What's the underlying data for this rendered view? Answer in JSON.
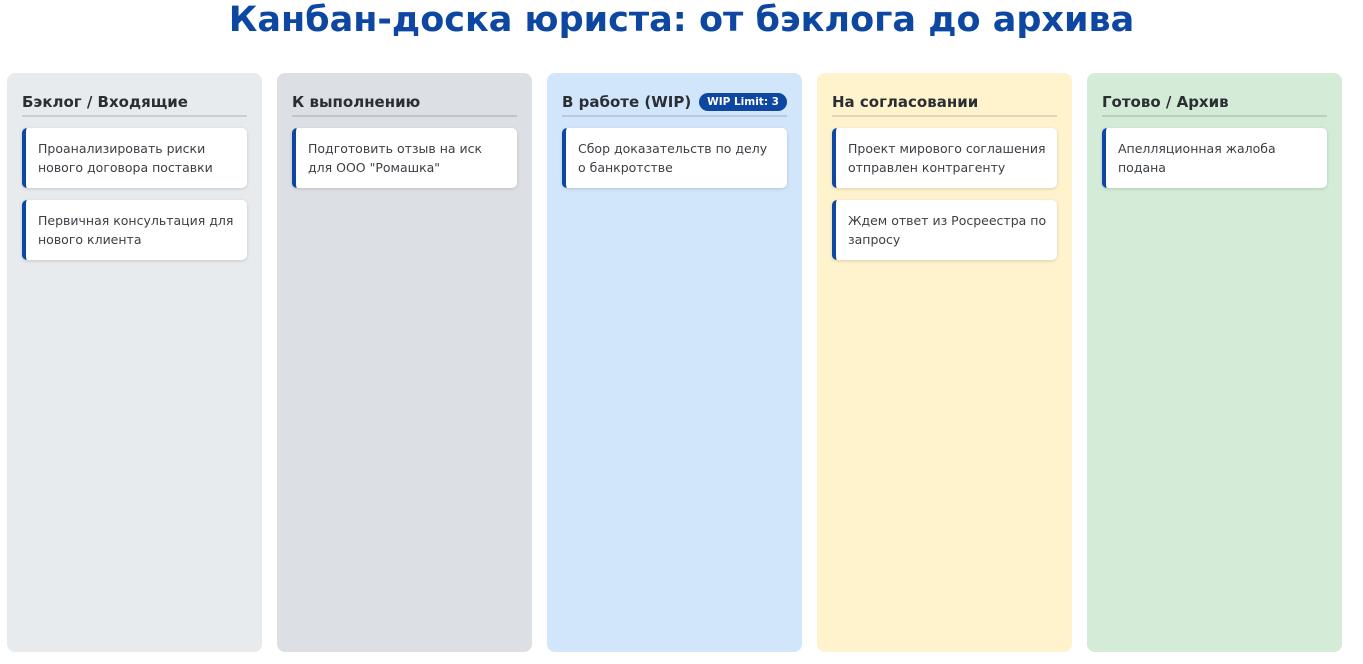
{
  "page": {
    "title": "Канбан-доска юриста: от бэклога до архива"
  },
  "colors": {
    "title": "#0d47a1",
    "accent": "#0d47a1"
  },
  "columns": [
    {
      "title": "Бэклог / Входящие",
      "background": "#e7ebee",
      "cards": [
        "Проанализировать риски нового договора поставки",
        "Первичная консультация для нового клиента"
      ]
    },
    {
      "title": "К выполнению",
      "background": "#dcdfe3",
      "cards": [
        "Подготовить отзыв на иск для ООО \"Ромашка\""
      ]
    },
    {
      "title": "В работе (WIP)",
      "background": "#d2e6fb",
      "badge": "WIP Limit: 3",
      "cards": [
        "Сбор доказательств по делу о банкротстве"
      ]
    },
    {
      "title": "На согласовании",
      "background": "#fef3cc",
      "cards": [
        "Проект мирового соглашения отправлен контрагенту",
        "Ждем ответ из Росреестра по запросу"
      ]
    },
    {
      "title": "Готово / Архив",
      "background": "#d4ebd8",
      "cards": [
        "Апелляционная жалоба подана"
      ]
    }
  ]
}
